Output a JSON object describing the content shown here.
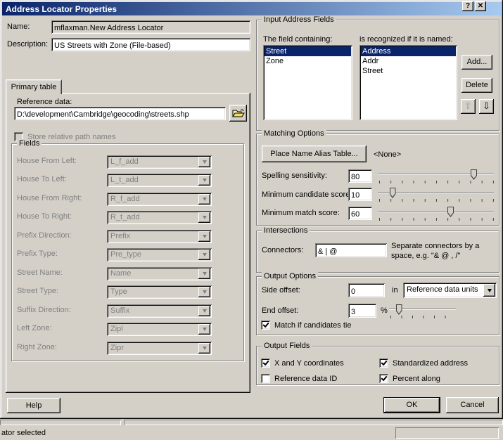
{
  "window": {
    "title": "Address Locator Properties"
  },
  "icons": {
    "help_glyph": "?",
    "close_glyph": "✕",
    "up_arrow_glyph": "⇧",
    "down_arrow_glyph": "⇩"
  },
  "header": {
    "name_label": "Name:",
    "name_value": "mflaxman.New Address Locator",
    "description_label": "Description:",
    "description_value": "US Streets with Zone (File-based)"
  },
  "primary_tab": {
    "tab_label": "Primary table",
    "reference_data_label": "Reference data:",
    "reference_data_value": "D:\\development\\Cambridge\\geocoding\\streets.shp",
    "store_relative_label": "Store relative path names",
    "store_relative_checked": false,
    "fields_group_label": "Fields",
    "fields": [
      {
        "label": "House From Left:",
        "value": "L_f_add"
      },
      {
        "label": "House To Left:",
        "value": "L_t_add"
      },
      {
        "label": "House From Right:",
        "value": "R_f_add"
      },
      {
        "label": "House To Right:",
        "value": "R_t_add"
      },
      {
        "label": "Prefix Direction:",
        "value": "Prefix"
      },
      {
        "label": "Prefix Type:",
        "value": "Pre_type"
      },
      {
        "label": "Street Name:",
        "value": "Name"
      },
      {
        "label": "Street Type:",
        "value": "Type"
      },
      {
        "label": "Suffix Direction:",
        "value": "Suffix"
      },
      {
        "label": "Left Zone:",
        "value": "Zipl"
      },
      {
        "label": "Right Zone:",
        "value": "Zipr"
      }
    ]
  },
  "input_address_fields": {
    "group_label": "Input Address Fields",
    "field_list_label": "The field containing:",
    "field_list": [
      "Street",
      "Zone"
    ],
    "field_list_selected": "Street",
    "alias_list_label": "is recognized if it is named:",
    "alias_list": [
      "Address",
      "Addr",
      "Street"
    ],
    "alias_list_selected": "Address",
    "add_button": "Add...",
    "delete_button": "Delete"
  },
  "matching_options": {
    "group_label": "Matching Options",
    "alias_table_button": "Place Name Alias Table...",
    "alias_table_value": "<None>",
    "spelling_label": "Spelling sensitivity:",
    "spelling_value": "80",
    "candidate_label": "Minimum candidate score:",
    "candidate_value": "10",
    "match_label": "Minimum match score:",
    "match_value": "60"
  },
  "intersections": {
    "group_label": "Intersections",
    "connectors_label": "Connectors:",
    "connectors_value": "& | @",
    "note_line1": "Separate connectors by a",
    "note_line2": "space, e.g. \"& @ , /\""
  },
  "output_options": {
    "group_label": "Output Options",
    "side_offset_label": "Side offset:",
    "side_offset_value": "0",
    "in_label": "in",
    "side_offset_units": "Reference data units",
    "end_offset_label": "End offset:",
    "end_offset_value": "3",
    "end_offset_unit": "%",
    "match_tie_label": "Match if candidates tie",
    "match_tie_checked": true
  },
  "output_fields": {
    "group_label": "Output Fields",
    "checkboxes": [
      {
        "label": "X and Y coordinates",
        "checked": true
      },
      {
        "label": "Standardized address",
        "checked": true
      },
      {
        "label": "Reference data ID",
        "checked": false
      },
      {
        "label": "Percent along",
        "checked": true
      }
    ]
  },
  "buttons": {
    "help": "Help",
    "ok": "OK",
    "cancel": "Cancel"
  },
  "status_bar": {
    "text": "ator selected"
  },
  "colors": {
    "titlebar_start": "#0a246a",
    "titlebar_end": "#a6caf0",
    "selection": "#0a246a",
    "dialog_bg": "#d4d0c8"
  }
}
